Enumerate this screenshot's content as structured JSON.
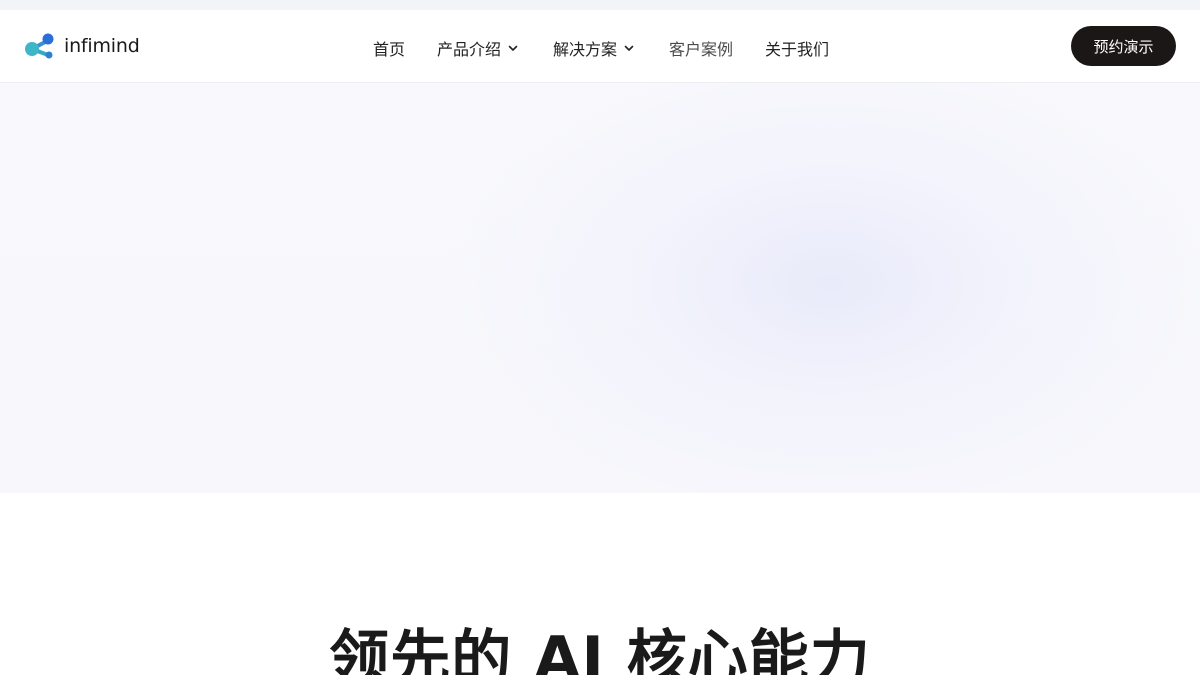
{
  "brand": {
    "name": "infimind"
  },
  "nav": {
    "items": [
      {
        "label": "首页",
        "has_dropdown": false
      },
      {
        "label": "产品介绍",
        "has_dropdown": true
      },
      {
        "label": "解决方案",
        "has_dropdown": true
      },
      {
        "label": "客户案例",
        "has_dropdown": false
      },
      {
        "label": "关于我们",
        "has_dropdown": false
      }
    ],
    "cta_label": "预约演示"
  },
  "main": {
    "section_title": "领先的 AI 核心能力"
  },
  "colors": {
    "cta_background": "#1c1717",
    "logo_primary": "#2a6fd6",
    "logo_secondary": "#3fb6c8"
  },
  "icons": [
    "logo-mark-icon",
    "chevron-down-icon"
  ]
}
